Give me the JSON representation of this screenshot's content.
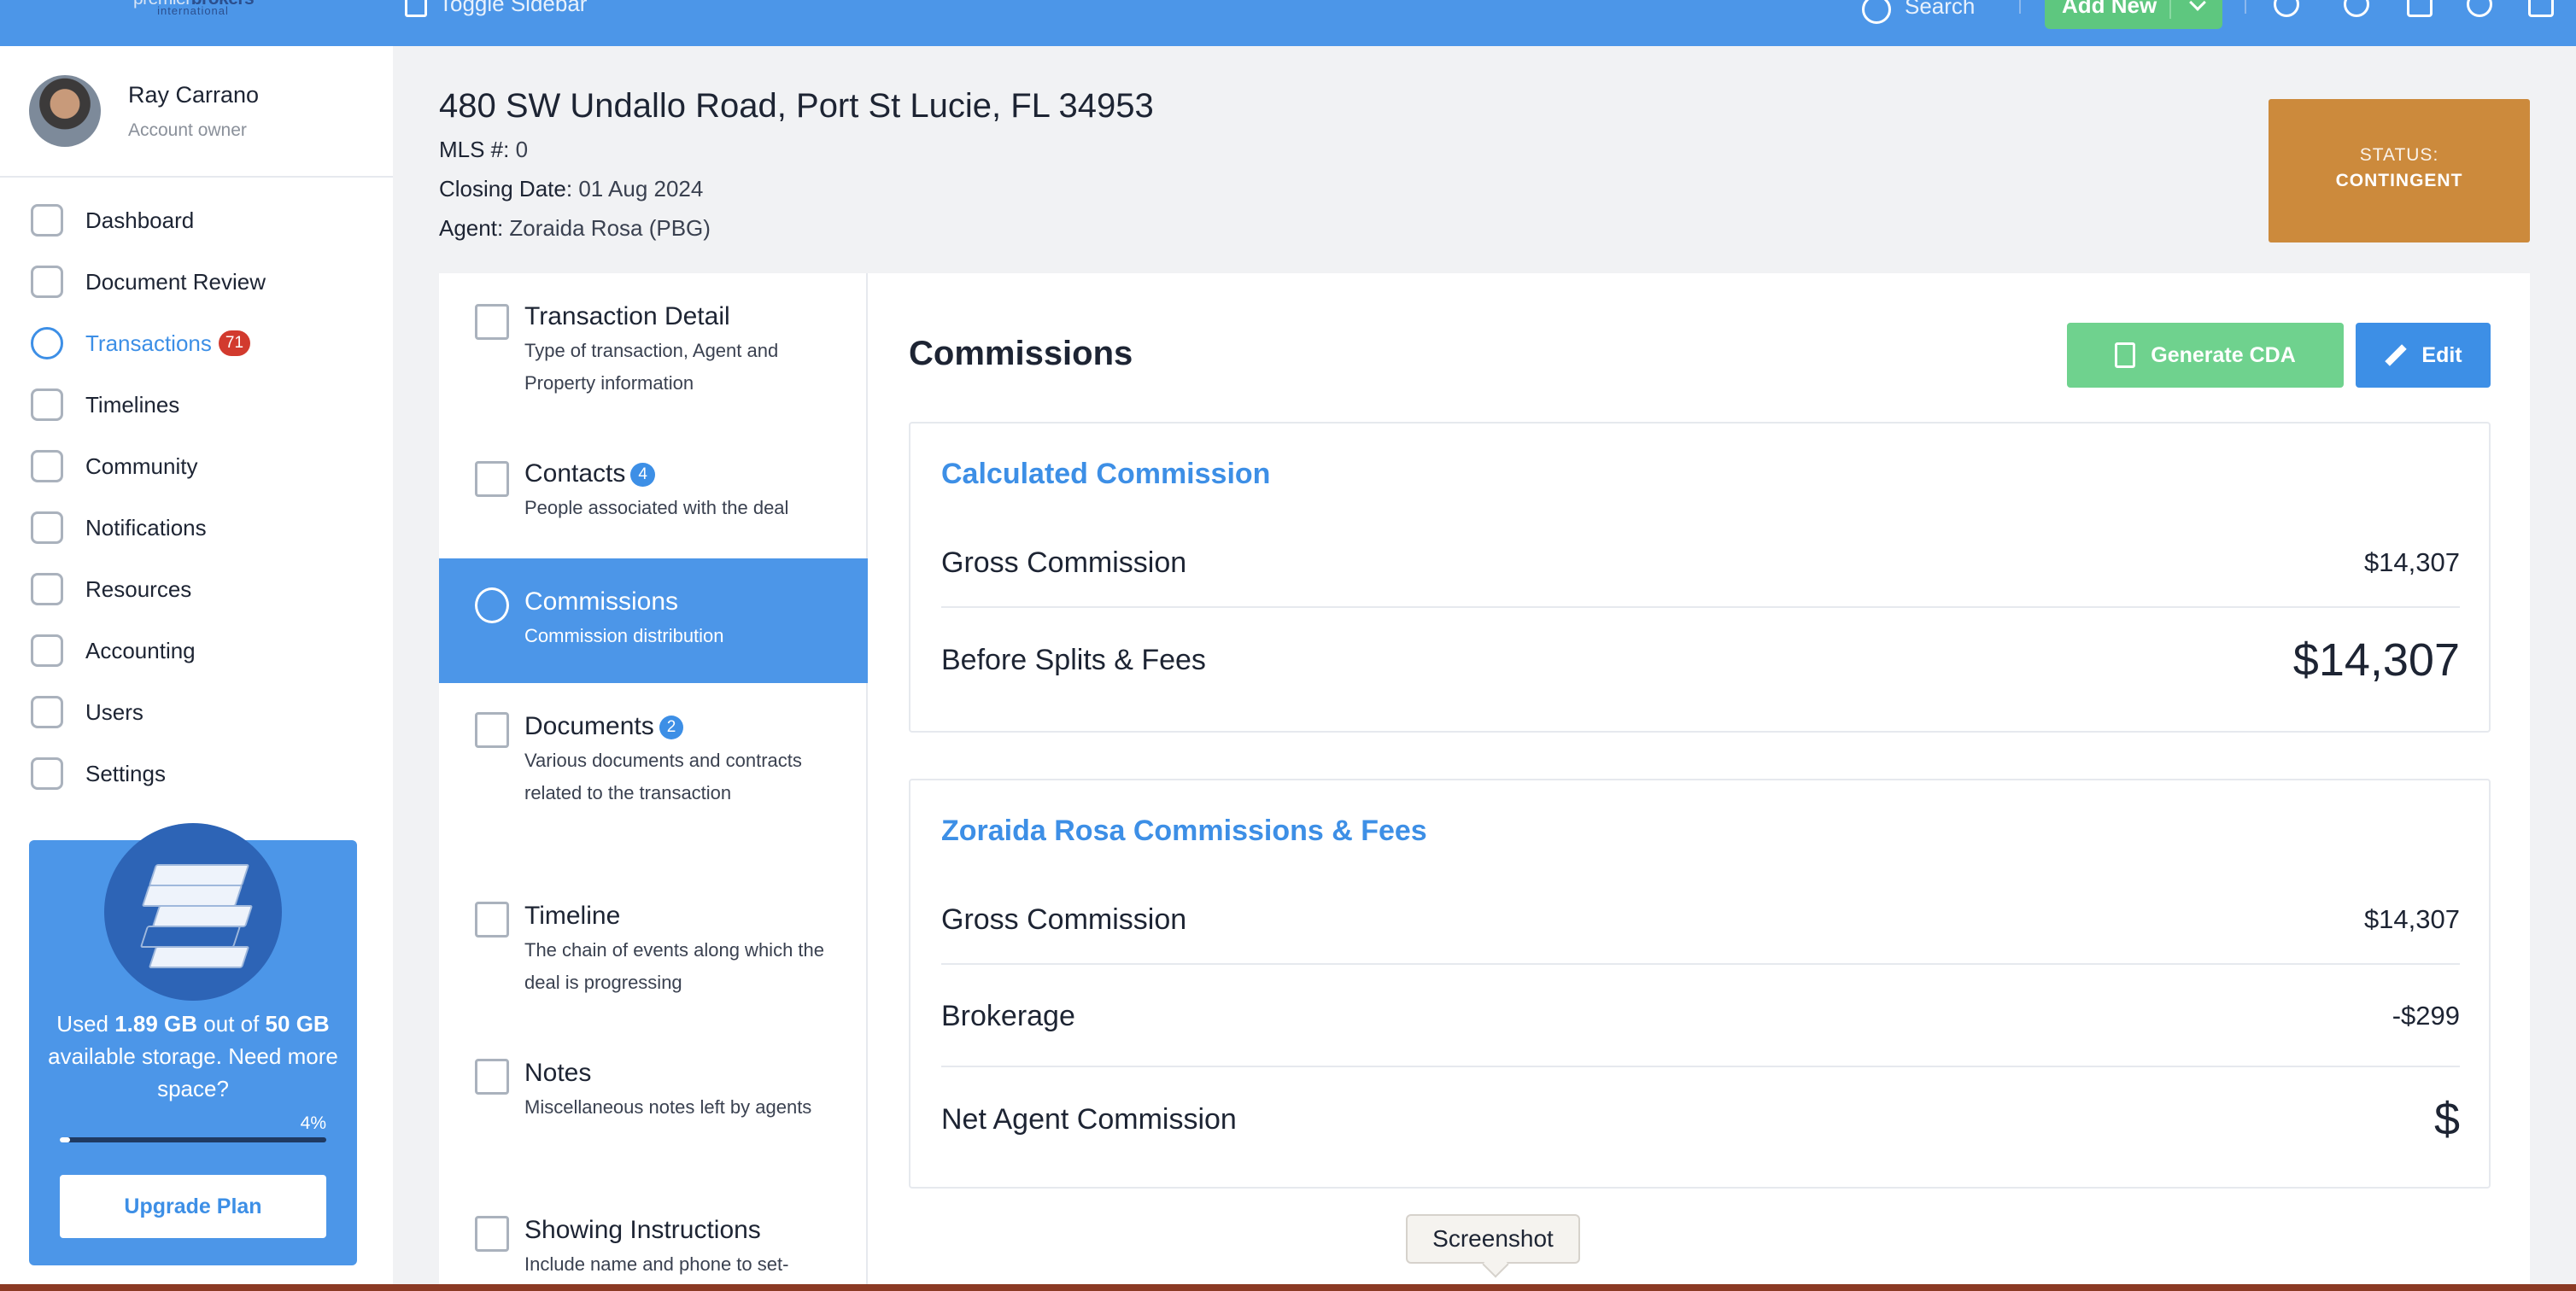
{
  "topbar": {
    "logo_line1_a": "premier",
    "logo_line1_b": "brokers",
    "logo_line2": "international",
    "toggle_label": "Toggle Sidebar",
    "search_label": "Search",
    "add_new_label": "Add New"
  },
  "user": {
    "name": "Ray Carrano",
    "role": "Account owner"
  },
  "nav": {
    "items": [
      {
        "label": "Dashboard"
      },
      {
        "label": "Document Review"
      },
      {
        "label": "Transactions",
        "badge": "71"
      },
      {
        "label": "Timelines"
      },
      {
        "label": "Community"
      },
      {
        "label": "Notifications"
      },
      {
        "label": "Resources"
      },
      {
        "label": "Accounting"
      },
      {
        "label": "Users"
      },
      {
        "label": "Settings"
      }
    ]
  },
  "storage": {
    "prefix": "Used ",
    "used": "1.89 GB",
    "middle": " out of ",
    "total": "50 GB",
    "suffix": " available storage. Need more space?",
    "percent_label": "4%",
    "percent": 4,
    "upgrade_label": "Upgrade Plan"
  },
  "transaction": {
    "address": "480 SW Undallo Road, Port St Lucie, FL 34953",
    "mls_label": "MLS #:",
    "mls_value": "0",
    "closing_label": "Closing Date:",
    "closing_value": "01 Aug 2024",
    "agent_label": "Agent:",
    "agent_value": "Zoraida Rosa (PBG)",
    "status_label": "STATUS:",
    "status_value": "CONTINGENT"
  },
  "subnav": {
    "items": [
      {
        "title": "Transaction Detail",
        "desc": "Type of transaction, Agent and Property information"
      },
      {
        "title": "Contacts",
        "badge": "4",
        "desc": "People associated with the deal"
      },
      {
        "title": "Commissions",
        "desc": "Commission distribution"
      },
      {
        "title": "Documents",
        "badge": "2",
        "desc": "Various documents and contracts related to the transaction"
      },
      {
        "title": "Timeline",
        "desc": "The chain of events along which the deal is progressing"
      },
      {
        "title": "Notes",
        "desc": "Miscellaneous notes left by agents"
      },
      {
        "title": "Showing Instructions",
        "desc": "Include name and phone to set-"
      }
    ]
  },
  "commissions": {
    "title": "Commissions",
    "generate_cda_label": "Generate CDA",
    "edit_label": "Edit",
    "calculated": {
      "title": "Calculated Commission",
      "gross_label": "Gross Commission",
      "gross_value": "$14,307",
      "before_label": "Before Splits & Fees",
      "before_value": "$14,307"
    },
    "agent": {
      "title": "Zoraida Rosa Commissions & Fees",
      "gross_label": "Gross Commission",
      "gross_value": "$14,307",
      "brokerage_label": "Brokerage",
      "brokerage_value": "-$299",
      "net_label": "Net Agent Commission",
      "net_value": "$"
    }
  },
  "tooltip": {
    "label": "Screenshot"
  }
}
